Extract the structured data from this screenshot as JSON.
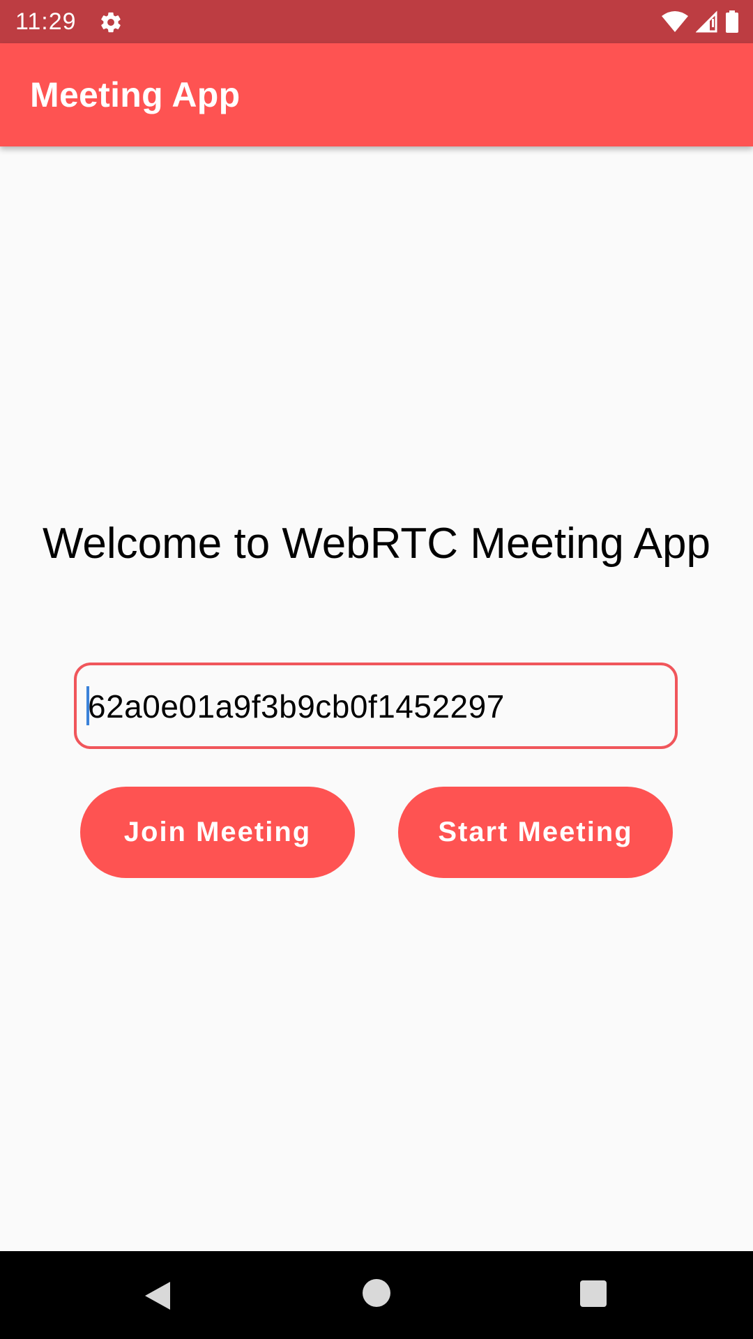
{
  "status_bar": {
    "time": "11:29",
    "icons": [
      "gear-icon",
      "wifi-icon",
      "signal-icon",
      "battery-icon"
    ]
  },
  "app_bar": {
    "title": "Meeting App"
  },
  "main": {
    "welcome_text": "Welcome to WebRTC Meeting App",
    "meeting_id_value": "62a0e01a9f3b9cb0f1452297",
    "join_label": "Join Meeting",
    "start_label": "Start Meeting"
  },
  "nav_bar": {
    "icons": [
      "back-icon",
      "home-icon",
      "recents-icon"
    ]
  },
  "colors": {
    "status_bar": "#bd3d42",
    "accent": "#fe5352",
    "input_border": "#f0565b",
    "caret": "#3b82d9",
    "background": "#fafafa"
  }
}
